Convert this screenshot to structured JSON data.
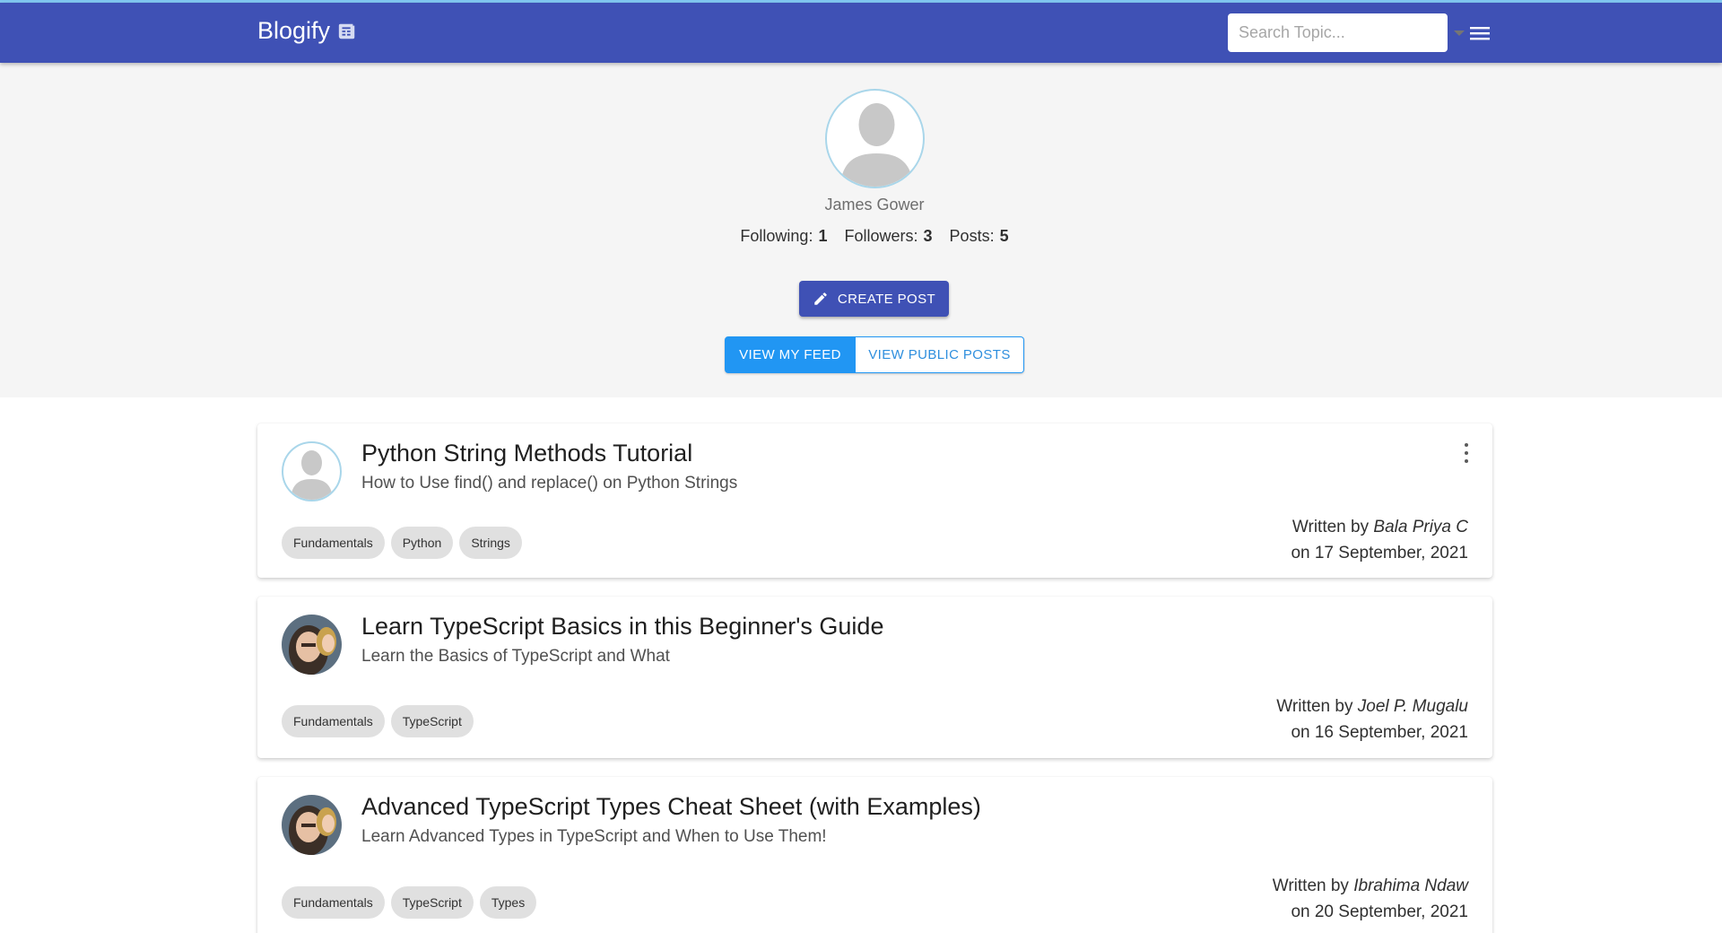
{
  "app": {
    "brand": "Blogify",
    "search": {
      "placeholder": "Search Topic..."
    }
  },
  "profile": {
    "name": "James Gower",
    "following_label": "Following:",
    "following": "1",
    "followers_label": "Followers:",
    "followers": "3",
    "posts_label": "Posts:",
    "posts": "5",
    "create_post_label": "CREATE POST",
    "view_feed_label": "VIEW MY FEED",
    "view_public_label": "VIEW PUBLIC POSTS"
  },
  "posts": [
    {
      "title": "Python String Methods Tutorial",
      "subtitle": "How to Use find() and replace() on Python Strings",
      "tags": [
        "Fundamentals",
        "Python",
        "Strings"
      ],
      "written_by_label": "Written by",
      "author": "Bala Priya C",
      "date": "on 17 September, 2021"
    },
    {
      "title": "Learn TypeScript Basics in this Beginner's Guide",
      "subtitle": "Learn the Basics of TypeScript and What",
      "tags": [
        "Fundamentals",
        "TypeScript"
      ],
      "written_by_label": "Written by",
      "author": "Joel P. Mugalu",
      "date": "on 16 September, 2021"
    },
    {
      "title": "Advanced TypeScript Types Cheat Sheet (with Examples)",
      "subtitle": "Learn Advanced Types in TypeScript and When to Use Them!",
      "tags": [
        "Fundamentals",
        "TypeScript",
        "Types"
      ],
      "written_by_label": "Written by",
      "author": "Ibrahima Ndaw",
      "date": "on 20 September, 2021"
    }
  ],
  "colors": {
    "appbar": "#3f51b5",
    "accent_blue": "#2196f3",
    "profile_bg": "#f5f5f5",
    "chip_bg": "#e0e0e0"
  },
  "icons": {
    "brand": "newspaper-icon",
    "menu": "hamburger-menu-icon",
    "create": "pencil-icon",
    "more": "more-vertical-icon",
    "avatar": "person-placeholder-icon"
  }
}
